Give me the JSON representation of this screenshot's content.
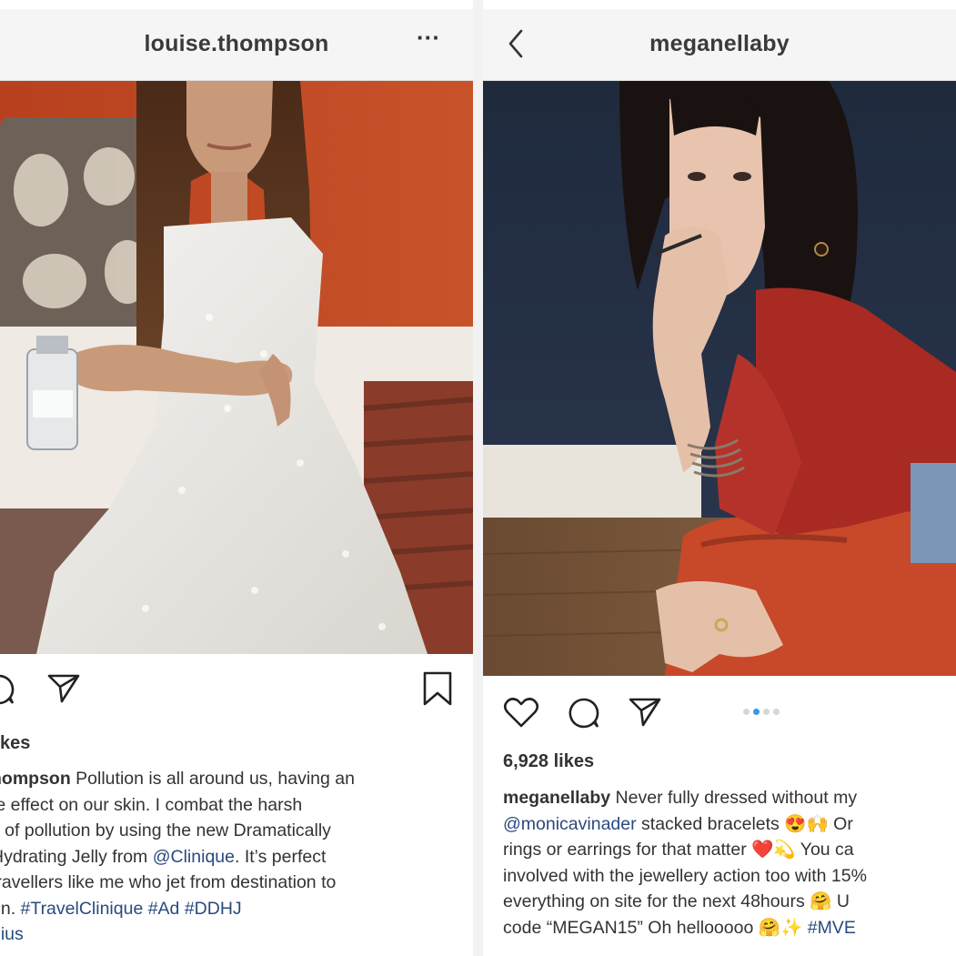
{
  "left_post": {
    "username": "louise.thompson",
    "more_label": "···",
    "likes": "kes",
    "caption": {
      "line1_user": "hompson",
      "line1_text": " Pollution is all around us, having an",
      "line2": "te effect on our skin. I combat the harsh",
      "line3": "s of pollution by using the new Dramatically",
      "line4_pre": " Hydrating Jelly from ",
      "line4_link": "@Clinique",
      "line4_post": ". It’s perfect",
      "line5": "travellers like me who jet from destination to",
      "line6_pre": "on. ",
      "line6_tags": "#TravelClinique #Ad #DDHJ",
      "line7": "nius"
    }
  },
  "right_post": {
    "username": "meganellaby",
    "likes": "6,928 likes",
    "carousel": {
      "count": 4,
      "active": 1
    },
    "caption": {
      "line1_user": "meganellaby",
      "line1_text": " Never fully dressed without my",
      "line2_link": "@monicavinader",
      "line2_text": " stacked bracelets 😍🙌 Or",
      "line3": "rings or earrings for that matter ❤️💫 You ca",
      "line4": "involved with the jewellery action too with 15%",
      "line5": "everything on site for the next 48hours 🤗 U",
      "line6_pre": "code “MEGAN15” Oh hellooooo 🤗✨ ",
      "line6_tag": "#MVE"
    }
  },
  "colors": {
    "link": "#2a4a7f",
    "header_bg": "#f5f5f5",
    "text": "#333333"
  },
  "icons": [
    "more-icon",
    "back-chevron-icon",
    "heart-icon",
    "comment-icon",
    "share-icon",
    "bookmark-icon",
    "carousel-dots"
  ]
}
